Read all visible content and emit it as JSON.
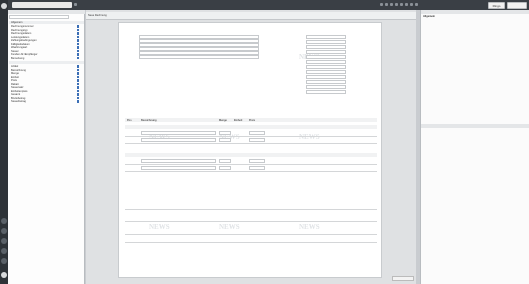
{
  "topbar": {
    "tab_label": "",
    "buttons": {
      "user": "Ringo",
      "right": ""
    }
  },
  "toolbar": {
    "items": [
      "Neue Rechnung",
      "",
      "",
      "",
      "",
      "",
      "",
      "",
      "",
      "",
      ""
    ]
  },
  "tree": {
    "header": "",
    "search_placeholder": "",
    "section_top": "Allgemein",
    "items": [
      "Rechnungsnummer",
      "Rechnungstyp",
      "Rechnungsdatum",
      "Leistungsdatum",
      "Zahlungsbedingungen",
      "Fälligkeitsdatum",
      "Waehrungsart",
      "Steuer",
      "Kunden-Nr./Empfänger",
      "Bemerkung"
    ],
    "section_mid": "",
    "items2": [
      "Artikel",
      "Bezeichnung",
      "Menge",
      "Einheit",
      "Preis",
      "Rabatt",
      "Steuersatz",
      "Einheitenpreis",
      "Gesamt",
      "Bruttobetrag",
      "Steuerbetrag"
    ]
  },
  "doc": {
    "title": "",
    "left_fields": [
      "",
      "",
      "",
      "",
      "",
      ""
    ],
    "right_fields": [
      {
        "label": "",
        "value": ""
      },
      {
        "label": "",
        "value": ""
      },
      {
        "label": "",
        "value": ""
      },
      {
        "label": "",
        "value": ""
      },
      {
        "label": "",
        "value": ""
      },
      {
        "label": "",
        "value": ""
      },
      {
        "label": "",
        "value": ""
      },
      {
        "label": "",
        "value": ""
      },
      {
        "label": "",
        "value": ""
      },
      {
        "label": "",
        "value": ""
      },
      {
        "label": "",
        "value": ""
      },
      {
        "label": "",
        "value": ""
      }
    ],
    "greeting": "",
    "intro": "",
    "table_headers": [
      "Pos",
      "Bezeichnung",
      "Menge",
      "Einheit",
      "Preis",
      "",
      "",
      "",
      "",
      "",
      "",
      ""
    ],
    "groups": [
      {
        "name": "",
        "rows": [
          {
            "pos": "",
            "desc": "",
            "qty": "",
            "unit": "",
            "price": "",
            "total": ""
          },
          {
            "pos": "",
            "desc": "",
            "qty": "",
            "unit": "",
            "price": "",
            "total": ""
          }
        ],
        "subtotal_label": "",
        "subtotal": ""
      },
      {
        "name": "",
        "rows": [
          {
            "pos": "",
            "desc": "",
            "qty": "",
            "unit": "",
            "price": "",
            "total": ""
          },
          {
            "pos": "",
            "desc": "",
            "qty": "",
            "unit": "",
            "price": "",
            "total": ""
          }
        ],
        "subtotal_label": "",
        "subtotal": ""
      }
    ],
    "sum_label": "",
    "sum_value": "",
    "sum_sub": "",
    "tax_label": "",
    "tax_value": "",
    "tax_sub": "",
    "total_label": "",
    "total_value": "",
    "notes": [
      "",
      "",
      "",
      ""
    ],
    "closing": "",
    "watermark": "NEWS"
  },
  "right": {
    "header1": "",
    "section1": "Allgemein",
    "rows1": [
      {
        "label": "",
        "value": ""
      },
      {
        "label": "",
        "value": ""
      },
      {
        "label": "",
        "value": ""
      },
      {
        "label": "",
        "value": ""
      },
      {
        "label": "",
        "value": ""
      },
      {
        "label": "",
        "value": ""
      },
      {
        "label": "",
        "value": ""
      },
      {
        "label": "",
        "value": ""
      },
      {
        "label": "",
        "value": ""
      },
      {
        "label": "",
        "value": ""
      },
      {
        "label": "",
        "value": ""
      },
      {
        "label": "",
        "value": ""
      },
      {
        "label": "",
        "value": ""
      },
      {
        "label": "",
        "value": ""
      },
      {
        "label": "",
        "value": ""
      },
      {
        "label": "",
        "value": ""
      },
      {
        "label": "",
        "value": ""
      },
      {
        "label": "",
        "value": ""
      },
      {
        "label": "",
        "value": ""
      },
      {
        "label": "",
        "value": ""
      },
      {
        "label": "",
        "value": ""
      },
      {
        "label": "",
        "value": ""
      }
    ],
    "header2": "",
    "section2": "",
    "rows2": [
      {
        "label": "",
        "value": ""
      },
      {
        "label": "",
        "value": ""
      },
      {
        "label": "",
        "value": ""
      },
      {
        "label": "",
        "value": ""
      },
      {
        "label": "",
        "value": ""
      },
      {
        "label": "",
        "value": ""
      },
      {
        "label": "",
        "value": ""
      },
      {
        "label": "",
        "value": ""
      }
    ]
  },
  "status": {
    "zoom": ""
  },
  "colors": {
    "rail": "#2e3338",
    "topbar": "#3a3f45",
    "accent": "#3b6fb6",
    "paper": "#ffffff"
  }
}
